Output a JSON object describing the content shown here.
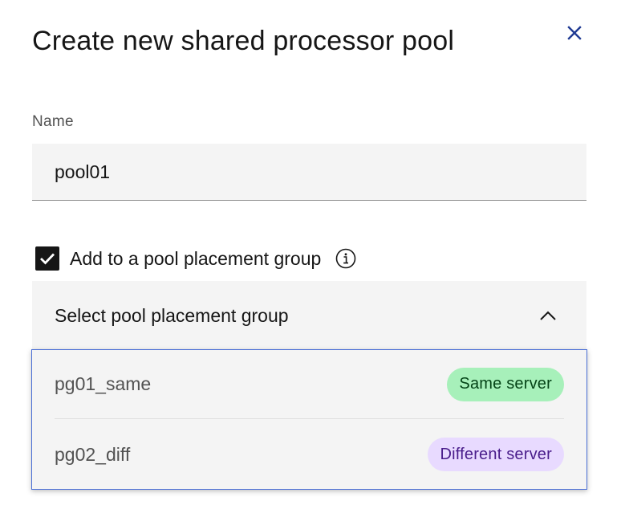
{
  "modal": {
    "title": "Create new shared processor pool",
    "close_icon": "close-icon"
  },
  "name_field": {
    "label": "Name",
    "value": "pool01"
  },
  "placement_checkbox": {
    "label": "Add to a pool placement group",
    "checked": true,
    "info_icon": "info-icon"
  },
  "placement_select": {
    "placeholder": "Select pool placement group",
    "expanded": true,
    "options": [
      {
        "label": "pg01_same",
        "tag": "Same server",
        "tag_color": "#a7f0ba"
      },
      {
        "label": "pg02_diff",
        "tag": "Different server",
        "tag_color": "#e8daff"
      }
    ]
  },
  "colors": {
    "text_primary": "#161616",
    "text_secondary": "#525252",
    "field_background": "#f4f4f4",
    "focus_border": "#4b6fd6"
  }
}
